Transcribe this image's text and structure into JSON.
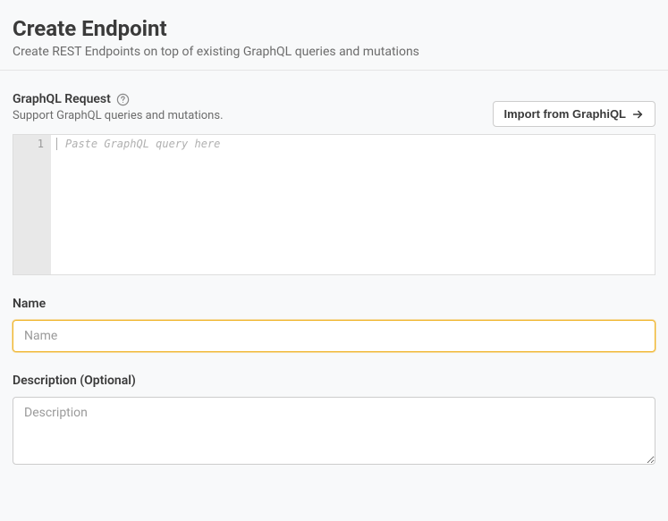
{
  "header": {
    "title": "Create Endpoint",
    "subtitle": "Create REST Endpoints on top of existing GraphQL queries and mutations"
  },
  "graphql": {
    "label": "GraphQL Request",
    "help": "Support GraphQL queries and mutations.",
    "import_button": "Import from GraphiQL",
    "line_number": "1",
    "placeholder": "Paste GraphQL query here"
  },
  "name": {
    "label": "Name",
    "placeholder": "Name",
    "value": ""
  },
  "description": {
    "label": "Description (Optional)",
    "placeholder": "Description",
    "value": ""
  }
}
